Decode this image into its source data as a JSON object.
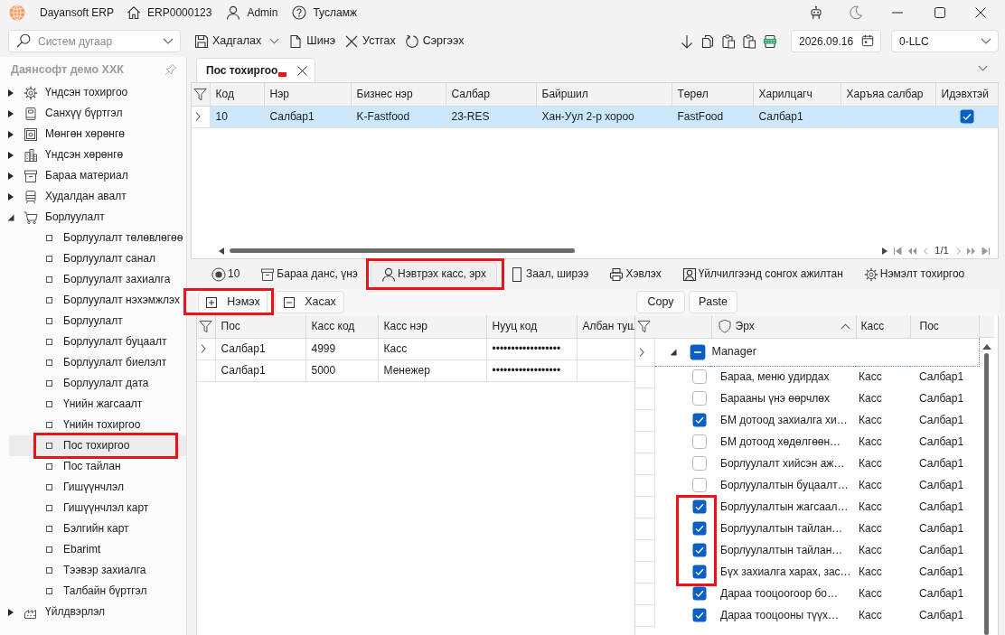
{
  "title_bar": {
    "app_name": "Dayansoft ERP",
    "document_number": "ERP0000123",
    "user": "Admin",
    "help": "Тусламж"
  },
  "toolbar": {
    "search": {
      "placeholder": "Систем дугаар"
    },
    "actions": [
      {
        "kind": "save",
        "label": "Хадгалах"
      },
      {
        "kind": "new",
        "label": "Шинэ"
      },
      {
        "kind": "delete",
        "label": "Устгах"
      },
      {
        "kind": "refresh",
        "label": "Сэргээх"
      }
    ],
    "date": "2026.09.16",
    "company": "0-LLC"
  },
  "sidebar": {
    "title": "Даянсофт демо ХХК",
    "items": [
      {
        "kind": "settings",
        "label": "Үндсэн тохиргоо",
        "expanded": false
      },
      {
        "kind": "finance",
        "label": "Санхүү бүртгэл",
        "expanded": false
      },
      {
        "kind": "cash",
        "label": "Мөнгөн хөрөнгө",
        "expanded": false
      },
      {
        "kind": "assets",
        "label": "Үндсэн хөрөнгө",
        "expanded": false
      },
      {
        "kind": "inventory",
        "label": "Бараа материал",
        "expanded": false
      },
      {
        "kind": "purchase",
        "label": "Худалдан авалт",
        "expanded": false
      },
      {
        "kind": "sales",
        "label": "Борлуулалт",
        "expanded": true,
        "children": [
          {
            "label": "Борлуулалт төлөвлөгөө",
            "selected": false,
            "highlighted": false
          },
          {
            "label": "Борлуулалт санал",
            "selected": false,
            "highlighted": false
          },
          {
            "label": "Борлуулалт захиалга",
            "selected": false,
            "highlighted": false
          },
          {
            "label": "Борлуулалт нэхэмжлэх",
            "selected": false,
            "highlighted": false
          },
          {
            "label": "Борлуулалт",
            "selected": false,
            "highlighted": false
          },
          {
            "label": "Борлуулалт буцаалт",
            "selected": false,
            "highlighted": false
          },
          {
            "label": "Борлуулалт биелэлт",
            "selected": false,
            "highlighted": false
          },
          {
            "label": "Борлуулалт дата",
            "selected": false,
            "highlighted": false
          },
          {
            "label": "Үнийн жагсаалт",
            "selected": false,
            "highlighted": false
          },
          {
            "label": "Үнийн тохиргоо",
            "selected": false,
            "highlighted": false
          },
          {
            "label": "Пос тохиргоо",
            "selected": true,
            "highlighted": true
          },
          {
            "label": "Пос тайлан",
            "selected": false,
            "highlighted": false
          },
          {
            "label": "Гишүүнчлэл",
            "selected": false,
            "highlighted": false
          },
          {
            "label": "Гишүүнчлэл карт",
            "selected": false,
            "highlighted": false
          },
          {
            "label": "Бэлгийн карт",
            "selected": false,
            "highlighted": false
          },
          {
            "label": "Ebarimt",
            "selected": false,
            "highlighted": false
          },
          {
            "label": "Тээвэр захиалга",
            "selected": false,
            "highlighted": false
          },
          {
            "label": "Талбайн бүртгэл",
            "selected": false,
            "highlighted": false
          }
        ]
      },
      {
        "kind": "production",
        "label": "Үйлдвэрлэл",
        "expanded": false
      }
    ]
  },
  "document_tabs": [
    {
      "label": "Пос тохиргоо",
      "selected": true,
      "marked": true
    }
  ],
  "main_grid": {
    "columns": [
      {
        "label": "Код",
        "kind": "text"
      },
      {
        "label": "Нэр",
        "kind": "text"
      },
      {
        "label": "Бизнес нэр",
        "kind": "text"
      },
      {
        "label": "Салбар",
        "kind": "text"
      },
      {
        "label": "Байршил",
        "kind": "text"
      },
      {
        "label": "Төрөл",
        "kind": "text"
      },
      {
        "label": "Харилцагч",
        "kind": "text"
      },
      {
        "label": "Харъяа салбар",
        "kind": "text"
      },
      {
        "label": "Идэвхтэй",
        "kind": "checkbox"
      }
    ],
    "rows": [
      {
        "selected": true,
        "cells": [
          "10",
          "Салбар1",
          "K-Fastfood",
          "23-RES",
          "Хан-Уул 2-р хороо",
          "FastFood",
          "Салбар1"
        ],
        "active": true
      }
    ],
    "pager": "1/1"
  },
  "detail_tabs": [
    {
      "kind": "radio",
      "label": "10",
      "selected": false,
      "highlighted": false
    },
    {
      "kind": "box",
      "label": "Бараа данс, үнэ",
      "selected": false,
      "highlighted": false
    },
    {
      "kind": "user",
      "label": "Нэвтрэх касс, эрх",
      "selected": true,
      "highlighted": true
    },
    {
      "kind": "square",
      "label": "Заал, ширээ",
      "selected": false,
      "highlighted": false
    },
    {
      "kind": "printer",
      "label": "Хэвлэх",
      "selected": false,
      "highlighted": false
    },
    {
      "kind": "user-card",
      "label": "Үйлчилгээнд сонгох ажилтан",
      "selected": false,
      "highlighted": false
    },
    {
      "kind": "gear",
      "label": "Нэмэлт тохиргоо",
      "selected": false,
      "highlighted": false
    }
  ],
  "cash_panel": {
    "buttons": [
      {
        "kind": "add",
        "label": "Нэмэх",
        "highlighted": true
      },
      {
        "kind": "remove",
        "label": "Хасах",
        "highlighted": false
      }
    ],
    "columns": [
      "Пос",
      "Касс код",
      "Касс нэр",
      "Нууц код",
      "Албан туш"
    ],
    "rows": [
      {
        "current": true,
        "cells": [
          "Салбар1",
          "4999",
          "Касс",
          "••••••••••••••••••"
        ]
      },
      {
        "current": false,
        "cells": [
          "Салбар1",
          "5000",
          "Менежер",
          "••••••••••••••••••"
        ]
      }
    ]
  },
  "rights_panel": {
    "buttons": [
      "Copy",
      "Paste"
    ],
    "columns": [
      {
        "label": "Эрх",
        "sorted": true
      },
      {
        "label": "Касс",
        "sorted": false
      },
      {
        "label": "Пос",
        "sorted": false
      }
    ],
    "group": {
      "label": "Manager",
      "expanded": true,
      "indeterminate": true,
      "current": true
    },
    "rows": [
      {
        "label": "Бараа, меню удирдах",
        "cash": "Касс",
        "pos": "Салбар1",
        "checked": false,
        "highlighted": false
      },
      {
        "label": "Барааны үнэ өөрчлөх",
        "cash": "Касс",
        "pos": "Салбар1",
        "checked": false,
        "highlighted": false
      },
      {
        "label": "БМ дотоод захиалга хи…",
        "cash": "Касс",
        "pos": "Салбар1",
        "checked": true,
        "highlighted": false
      },
      {
        "label": "БМ дотоод хөдөлгөөн…",
        "cash": "Касс",
        "pos": "Салбар1",
        "checked": false,
        "highlighted": false
      },
      {
        "label": "Борлуулалт хийсэн аж…",
        "cash": "Касс",
        "pos": "Салбар1",
        "checked": false,
        "highlighted": false
      },
      {
        "label": "Борлуулалтын буцаалт…",
        "cash": "Касс",
        "pos": "Салбар1",
        "checked": false,
        "highlighted": false
      },
      {
        "label": "Борлуулалтын жагсаал…",
        "cash": "Касс",
        "pos": "Салбар1",
        "checked": true,
        "highlighted": true
      },
      {
        "label": "Борлуулалтын тайлан…",
        "cash": "Касс",
        "pos": "Салбар1",
        "checked": true,
        "highlighted": true
      },
      {
        "label": "Борлуулалтын тайлан…",
        "cash": "Касс",
        "pos": "Салбар1",
        "checked": true,
        "highlighted": true
      },
      {
        "label": "Бүх захиалга харах, зас…",
        "cash": "Касс",
        "pos": "Салбар1",
        "checked": true,
        "highlighted": true
      },
      {
        "label": "Дараа тооцоогоор бо…",
        "cash": "Касс",
        "pos": "Салбар1",
        "checked": true,
        "highlighted": false
      },
      {
        "label": "Дараа тооцооны түүх…",
        "cash": "Касс",
        "pos": "Салбар1",
        "checked": true,
        "highlighted": false
      }
    ]
  }
}
